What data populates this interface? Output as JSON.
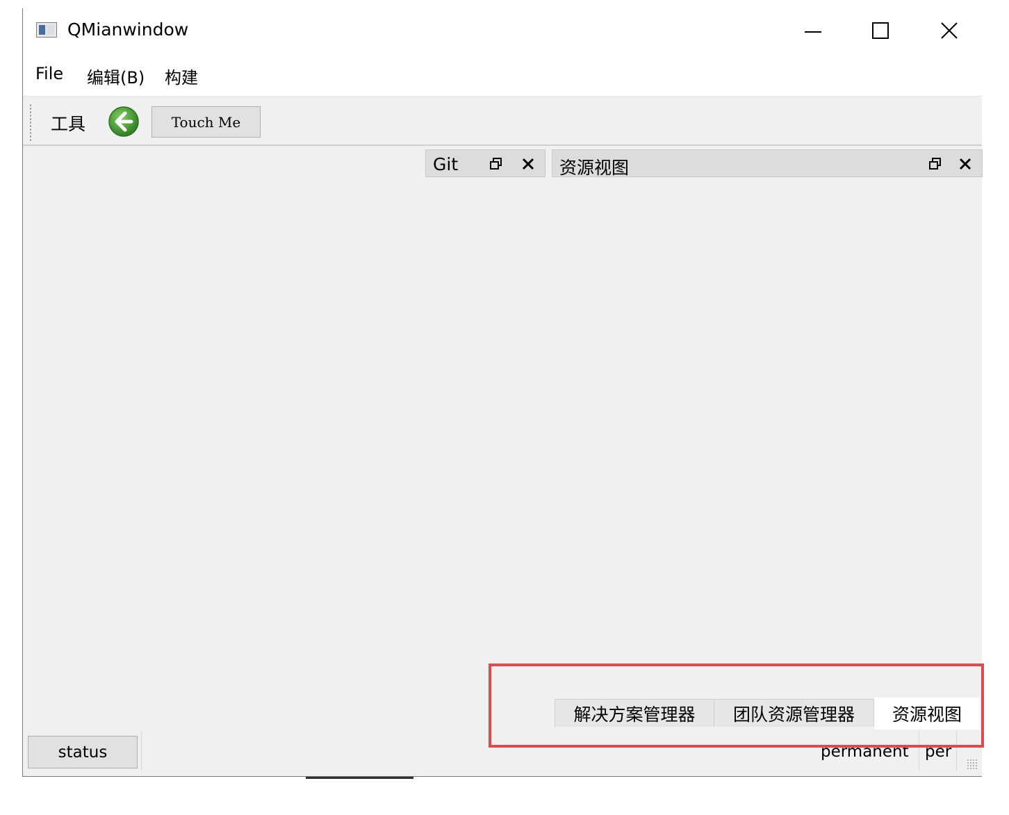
{
  "window": {
    "title": "QMianwindow"
  },
  "menubar": {
    "items": [
      "File",
      "编辑(B)",
      "构建"
    ]
  },
  "toolbar": {
    "tools_label": "工具",
    "touch_label": "Touch Me"
  },
  "docks": {
    "git_title": "Git",
    "resource_title": "资源视图"
  },
  "tabs": {
    "items": [
      "解决方案管理器",
      "团队资源管理器",
      "资源视图"
    ],
    "active_index": 2
  },
  "statusbar": {
    "status_label": "status",
    "permanent_1": "permanent",
    "permanent_2": "per"
  },
  "colors": {
    "highlight": "#e04a4a",
    "back_icon": "#3f9b2f"
  },
  "icons": {
    "app": "app-window-icon",
    "back": "arrow-left-circle-icon",
    "minimize": "minimize-icon",
    "maximize": "maximize-icon",
    "close": "close-icon",
    "float": "float-icon"
  }
}
